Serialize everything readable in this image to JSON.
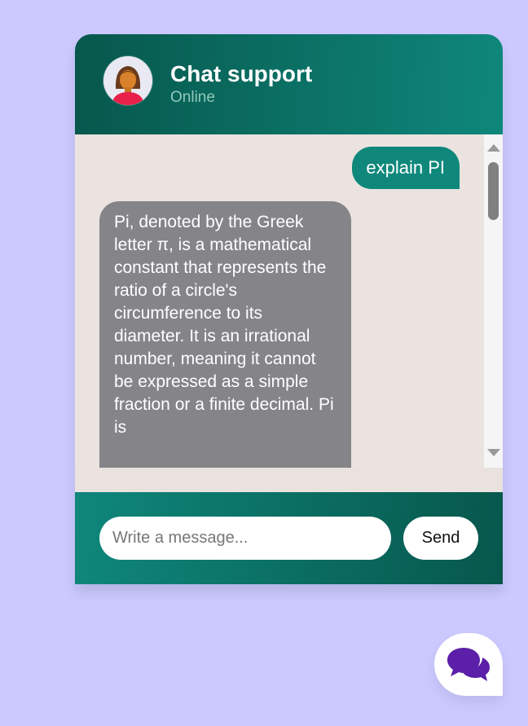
{
  "header": {
    "title": "Chat support",
    "status": "Online",
    "avatar_icon": "woman-avatar-icon"
  },
  "messages": [
    {
      "sender": "user",
      "text": "explain PI"
    },
    {
      "sender": "bot",
      "text": "Pi, denoted by the Greek letter π, is a mathematical constant that represents the ratio of a circle's circumference to its diameter. It is an irrational number, meaning it cannot be expressed as a simple fraction or a finite decimal. Pi is"
    }
  ],
  "composer": {
    "placeholder": "Write a message...",
    "send_label": "Send"
  },
  "launcher": {
    "icon": "chat-bubbles-icon"
  },
  "colors": {
    "page_background": "#cbc9fe",
    "header_dark": "#07574c",
    "header_light": "#0f877b",
    "user_bubble": "#0f887b",
    "bot_bubble": "#858488",
    "messages_background": "#eae3df",
    "launcher_icon": "#5b1fa8"
  }
}
